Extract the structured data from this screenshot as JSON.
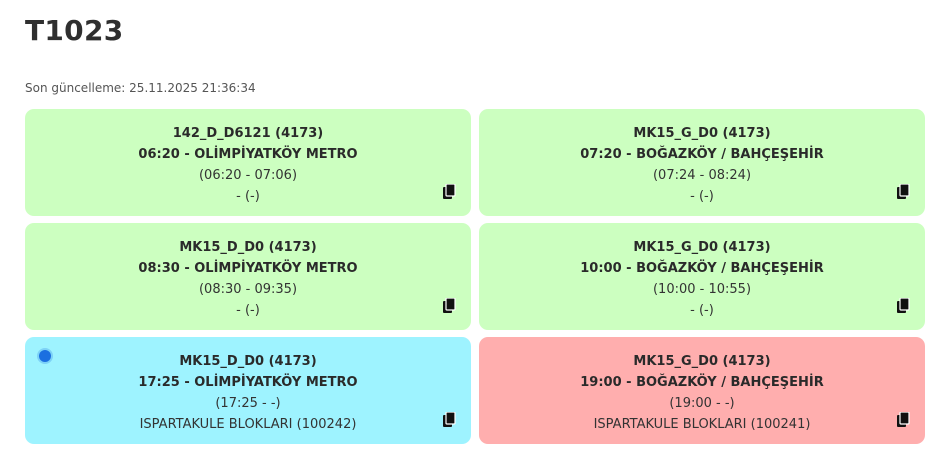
{
  "page": {
    "title": "T1023",
    "last_update": "Son güncelleme: 25.11.2025 21:36:34"
  },
  "colors": {
    "green": "#ccffc0",
    "blue": "#9ef3ff",
    "red": "#ffaeae"
  },
  "cards": [
    {
      "color": "green",
      "code": "142_D_D6121 (4173)",
      "route": "06:20 - OLİMPİYATKÖY METRO",
      "times": "(06:20 - 07:06)",
      "vehicle": "- (-)",
      "marker": false,
      "copy_icon": "copy-icon"
    },
    {
      "color": "green",
      "code": "MK15_G_D0 (4173)",
      "route": "07:20 - BOĞAZKÖY / BAHÇEŞEHİR",
      "times": "(07:24 - 08:24)",
      "vehicle": "- (-)",
      "marker": false,
      "copy_icon": "copy-icon"
    },
    {
      "color": "green",
      "code": "MK15_D_D0 (4173)",
      "route": "08:30 - OLİMPİYATKÖY METRO",
      "times": "(08:30 - 09:35)",
      "vehicle": "- (-)",
      "marker": false,
      "copy_icon": "copy-icon"
    },
    {
      "color": "green",
      "code": "MK15_G_D0 (4173)",
      "route": "10:00 - BOĞAZKÖY / BAHÇEŞEHİR",
      "times": "(10:00 - 10:55)",
      "vehicle": "- (-)",
      "marker": false,
      "copy_icon": "copy-icon"
    },
    {
      "color": "blue",
      "code": "MK15_D_D0 (4173)",
      "route": "17:25 - OLİMPİYATKÖY METRO",
      "times": "(17:25 - -)",
      "vehicle": "ISPARTAKULE BLOKLARI (100242)",
      "marker": true,
      "copy_icon": "copy-icon"
    },
    {
      "color": "red",
      "code": "MK15_G_D0 (4173)",
      "route": "19:00 - BOĞAZKÖY / BAHÇEŞEHİR",
      "times": "(19:00 - -)",
      "vehicle": "ISPARTAKULE BLOKLARI (100241)",
      "marker": false,
      "copy_icon": "copy-icon"
    }
  ]
}
